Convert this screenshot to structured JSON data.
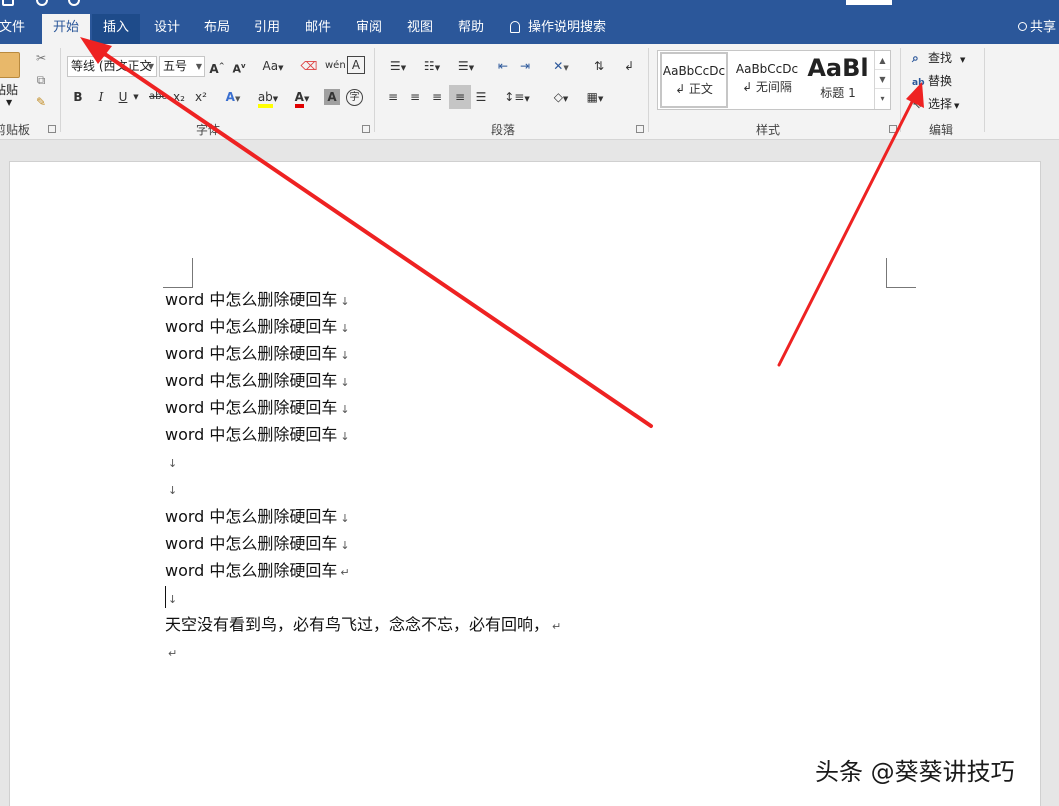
{
  "title_bar": {
    "title_text": ""
  },
  "tabs": [
    {
      "label": "文件"
    },
    {
      "label": "开始"
    },
    {
      "label": "插入"
    },
    {
      "label": "设计"
    },
    {
      "label": "布局"
    },
    {
      "label": "引用"
    },
    {
      "label": "邮件"
    },
    {
      "label": "审阅"
    },
    {
      "label": "视图"
    },
    {
      "label": "帮助"
    }
  ],
  "search_label": "操作说明搜索",
  "share_label": "共享",
  "ribbon": {
    "clipboard": {
      "paste": "粘贴",
      "label": "剪贴板"
    },
    "font": {
      "font_name": "等线 (西文正文",
      "font_size": "五号",
      "change_case": "Aa",
      "bold": "B",
      "italic": "I",
      "underline": "U",
      "strike": "abc",
      "subscript": "x₂",
      "superscript": "x²",
      "grow": "A",
      "shrink": "A",
      "label": "字体"
    },
    "paragraph": {
      "label": "段落"
    },
    "styles": {
      "items": [
        {
          "preview": "AaBbCcDc",
          "name": "↲ 正文"
        },
        {
          "preview": "AaBbCcDc",
          "name": "↲ 无间隔"
        },
        {
          "preview": "AaBl",
          "name": "标题 1"
        }
      ],
      "label": "样式"
    },
    "editing": {
      "find": "查找",
      "replace": "替换",
      "select": "选择",
      "label": "编辑"
    }
  },
  "document": {
    "lines": [
      {
        "text": "word 中怎么删除硬回车",
        "mark": "↓"
      },
      {
        "text": "word 中怎么删除硬回车",
        "mark": "↓"
      },
      {
        "text": "word 中怎么删除硬回车",
        "mark": "↓"
      },
      {
        "text": "word 中怎么删除硬回车",
        "mark": "↓"
      },
      {
        "text": "word 中怎么删除硬回车",
        "mark": "↓"
      },
      {
        "text": "word 中怎么删除硬回车",
        "mark": "↓"
      },
      {
        "text": "",
        "mark": "↓"
      },
      {
        "text": "",
        "mark": "↓"
      },
      {
        "text": "word 中怎么删除硬回车",
        "mark": "↓"
      },
      {
        "text": "word 中怎么删除硬回车",
        "mark": "↓"
      },
      {
        "text": "word 中怎么删除硬回车",
        "mark": "↵"
      },
      {
        "text": "",
        "mark": "↓"
      },
      {
        "text": "天空没有看到鸟，必有鸟飞过，念念不忘，必有回响，",
        "mark": "↵"
      },
      {
        "text": "",
        "mark": "↵"
      }
    ]
  },
  "watermark": "头条 @葵葵讲技巧",
  "colors": {
    "ribbon_blue": "#2b579a",
    "annotation_red": "#ee2222",
    "highlight_yellow": "#ffff00",
    "font_red": "#e00000"
  }
}
